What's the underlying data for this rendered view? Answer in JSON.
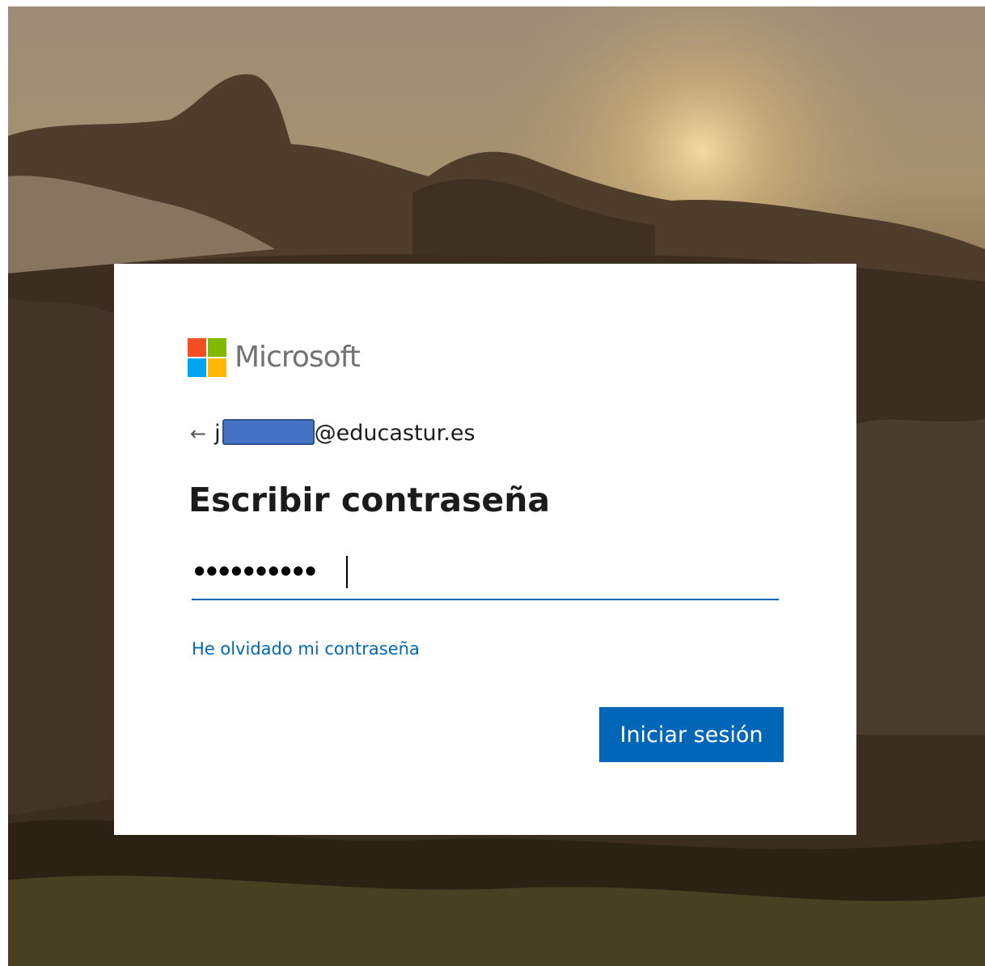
{
  "brand": {
    "name": "Microsoft",
    "colors": [
      "#f25022",
      "#7fba00",
      "#00a4ef",
      "#ffb900"
    ]
  },
  "identity": {
    "back_icon": "back-arrow-icon",
    "email_prefix": "j",
    "email_domain": "@educastur.es"
  },
  "title": "Escribir contraseña",
  "password": {
    "masked_value": "••••••••••"
  },
  "forgot_link": "He olvidado mi contraseña",
  "signin_button": "Iniciar sesión",
  "colors": {
    "accent": "#0067b8",
    "redaction": "#4472c4"
  }
}
